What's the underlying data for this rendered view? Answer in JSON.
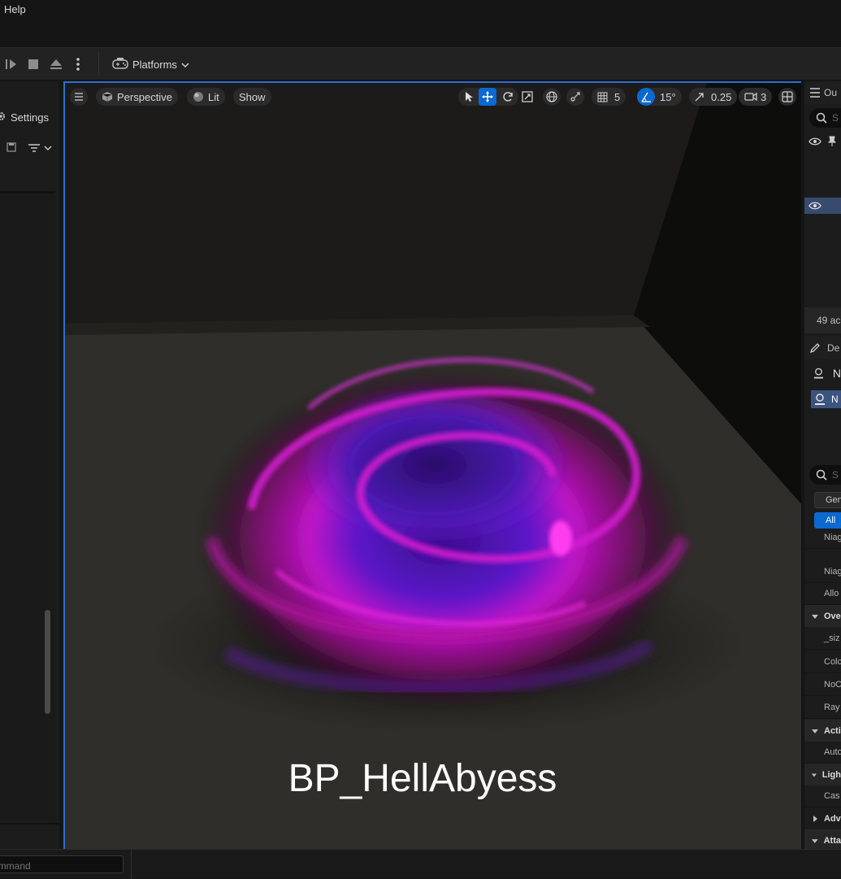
{
  "menu": {
    "help": "Help"
  },
  "toolbar": {
    "platforms_label": "Platforms",
    "icons": [
      "play-next-icon",
      "stop-icon",
      "eject-icon",
      "more-vertical-icon",
      "gamepad-icon",
      "chevron-down-icon"
    ]
  },
  "left_panel": {
    "settings_label": "Settings",
    "icons": [
      "gear-icon",
      "save-icon",
      "filter-icon",
      "chevron-down-icon"
    ]
  },
  "viewport": {
    "view_mode": "Perspective",
    "lighting_mode": "Lit",
    "show_label": "Show",
    "grid_snap_value": "5",
    "rotation_snap_value": "15°",
    "scale_snap_value": "0.25",
    "camera_speed_value": "3",
    "caption": "BP_HellAbyess",
    "icons": [
      "hamburger-menu-icon",
      "cube-icon",
      "sphere-icon",
      "select-cursor-icon",
      "translate-icon",
      "rotate-icon",
      "scale-icon",
      "globe-icon",
      "surface-snap-icon",
      "grid-icon",
      "angle-icon",
      "scale-arrow-icon",
      "camera-icon",
      "maximize-layout-icon"
    ]
  },
  "right_panel": {
    "outliner_tab": "Ou",
    "search_placeholder": "S",
    "actor_count": "49 ac",
    "details_tab": "De",
    "component_root": "N",
    "component_selected": "N",
    "details_search_placeholder": "S",
    "filter_general": "Gen",
    "filter_all": "All",
    "rows": [
      {
        "kind": "row",
        "label": "Niag"
      },
      {
        "kind": "row",
        "label": "Niag"
      },
      {
        "kind": "row",
        "label": "Allo"
      },
      {
        "kind": "cat",
        "label": "Ove"
      },
      {
        "kind": "row",
        "label": "_siz"
      },
      {
        "kind": "row",
        "label": "Colc"
      },
      {
        "kind": "row",
        "label": "NoC"
      },
      {
        "kind": "row",
        "label": "Ray"
      },
      {
        "kind": "cat",
        "label": "Acti"
      },
      {
        "kind": "row",
        "label": "Auto"
      },
      {
        "kind": "cat",
        "label": "Ligh"
      },
      {
        "kind": "row",
        "label": "Cas"
      },
      {
        "kind": "cat-collapsed",
        "label": "Adv"
      },
      {
        "kind": "cat",
        "label": "Atta"
      }
    ]
  },
  "bottom_bar": {
    "command_placeholder": "ommand"
  },
  "colors": {
    "accent": "#0b69d1",
    "background": "#151515",
    "panel": "#1c1c1c",
    "vortex_magenta": "#c014c8",
    "vortex_violet": "#5a18c8"
  }
}
